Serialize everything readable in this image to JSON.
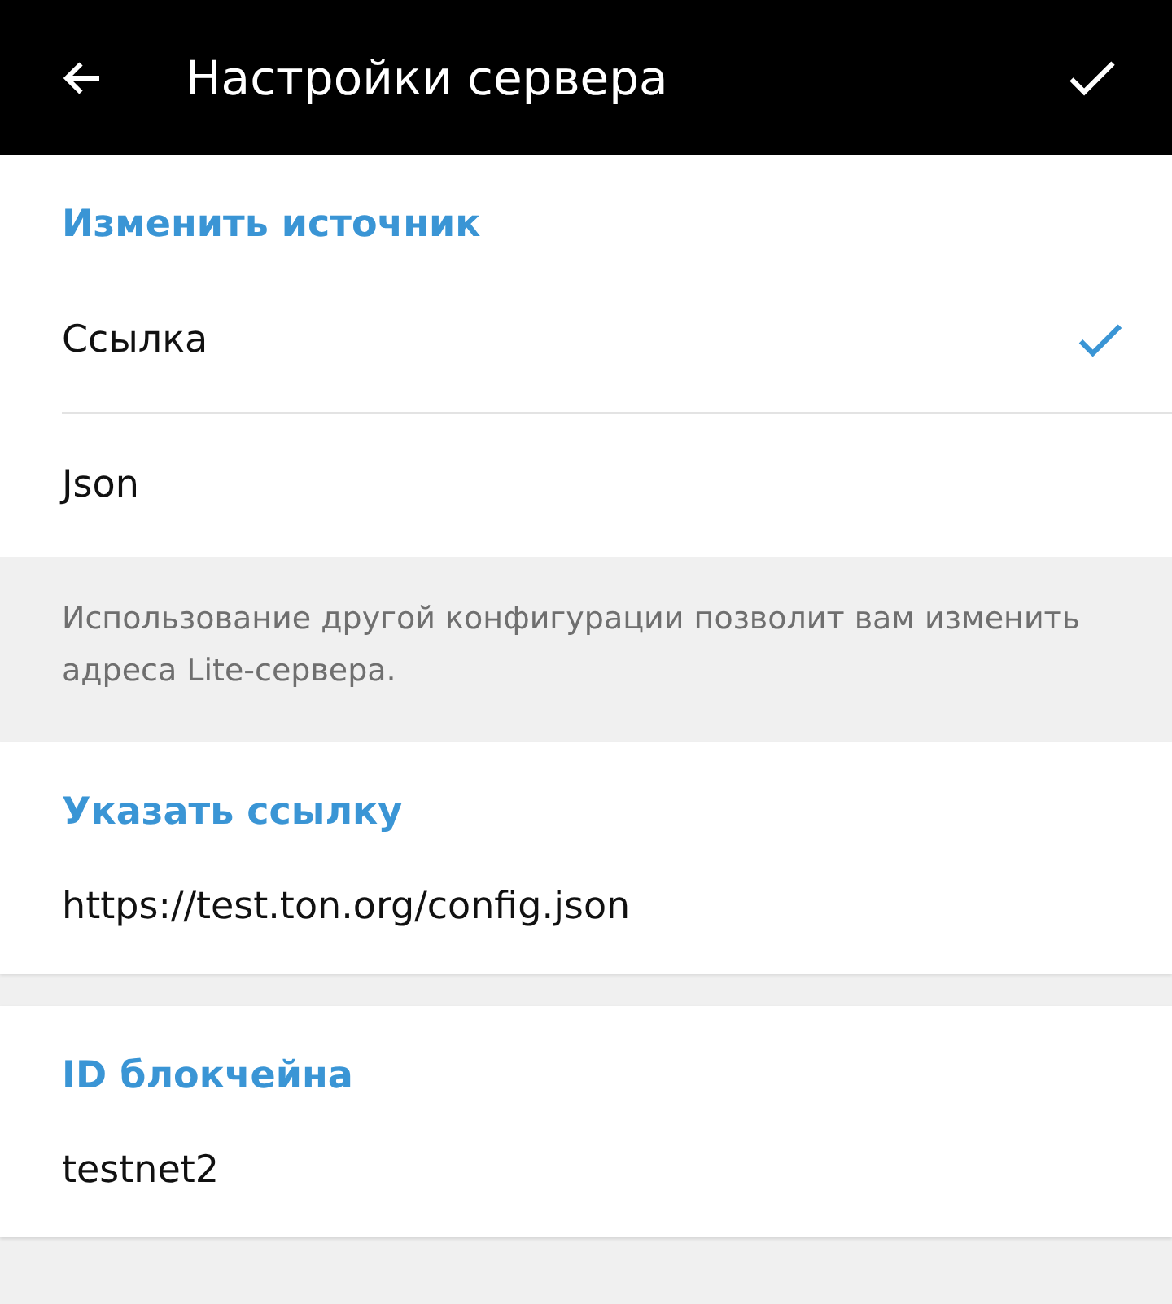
{
  "header": {
    "title": "Настройки сервера"
  },
  "source": {
    "title": "Изменить источник",
    "options": [
      {
        "label": "Ссылка",
        "selected": true
      },
      {
        "label": "Json",
        "selected": false
      }
    ]
  },
  "hint": "Использование другой конфигурации позволит вам изменить адреса Lite-сервера.",
  "sections": [
    {
      "title": "Указать ссылку",
      "value": "https://test.ton.org/config.json"
    },
    {
      "title": "ID блокчейна",
      "value": "testnet2"
    }
  ]
}
